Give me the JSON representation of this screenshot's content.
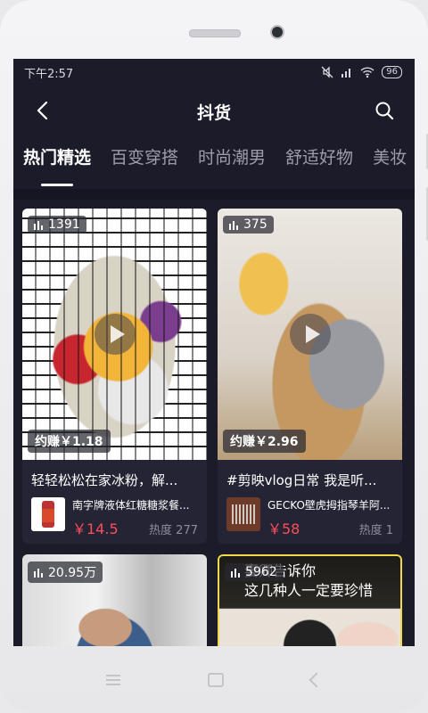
{
  "status_bar": {
    "time": "下午2:57",
    "battery": "96"
  },
  "header": {
    "title": "抖货"
  },
  "tabs": [
    {
      "label": "热门精选",
      "active": true
    },
    {
      "label": "百变穿搭",
      "active": false
    },
    {
      "label": "时尚潮男",
      "active": false
    },
    {
      "label": "舒适好物",
      "active": false
    },
    {
      "label": "美妆",
      "active": false
    }
  ],
  "cards": [
    {
      "views": "1391",
      "earn": "约赚￥1.18",
      "title": "轻轻松松在家冰粉，解...",
      "product_name": "南字牌液体红糖糖浆餐...",
      "price": "￥14.5",
      "heat": "热度 277"
    },
    {
      "views": "375",
      "earn": "约赚￥2.96",
      "title": "#剪映vlog日常 我是听...",
      "product_name": "GECKO壁虎拇指琴羊阿...",
      "price": "￥58",
      "heat": "热度 1"
    },
    {
      "views": "20.95万"
    },
    {
      "views": "5962",
      "overlay": "妻卿告诉你\n这几种人一定要珍惜"
    }
  ],
  "colors": {
    "screen_bg": "#1b1b2a",
    "card_bg": "#242435",
    "price": "#ff4d5a",
    "tab_inactive": "#9d9da8"
  }
}
